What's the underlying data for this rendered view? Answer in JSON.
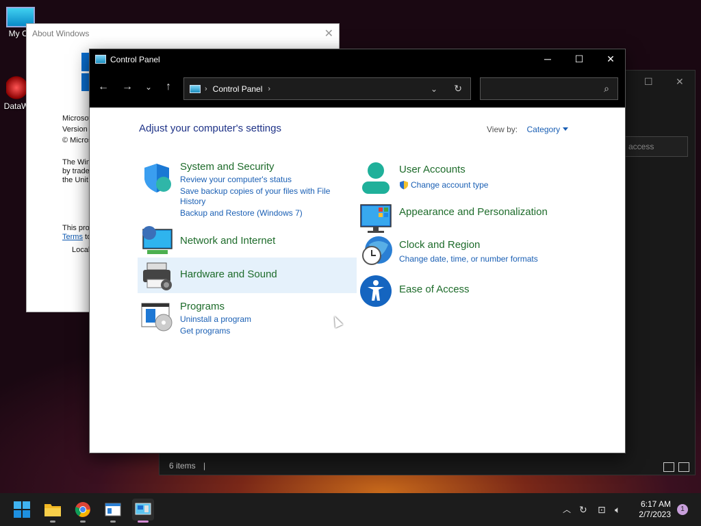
{
  "desktop": {
    "icons": [
      {
        "label": "My Co"
      },
      {
        "label": "DataW"
      }
    ]
  },
  "back_window": {
    "search_placeholder": "access",
    "status": "6 items",
    "status_sep": "|"
  },
  "about_window": {
    "title": "About Windows",
    "lines": [
      "Microsof",
      "Version",
      "© Micros"
    ],
    "para": [
      "The Win",
      "by trade",
      "the Unit"
    ],
    "license_prefix": "This pro",
    "terms": "Terms",
    "terms_suffix": "to",
    "local": "Local"
  },
  "cp": {
    "title": "Control Panel",
    "address_crumb": "Control Panel",
    "search_placeholder": "",
    "heading": "Adjust your computer's settings",
    "viewby_label": "View by:",
    "viewby_value": "Category",
    "categories": [
      {
        "title": "System and Security",
        "links": [
          "Review your computer's status",
          "Save backup copies of your files with File",
          "History",
          "Backup and Restore (Windows 7)"
        ]
      },
      {
        "title": "Network and Internet",
        "links": []
      },
      {
        "title": "Hardware and Sound",
        "links": []
      },
      {
        "title": "Programs",
        "links": [
          "Uninstall a program",
          "Get programs"
        ]
      },
      {
        "title": "User Accounts",
        "links": [
          "Change account type"
        ]
      },
      {
        "title": "Appearance and Personalization",
        "links": []
      },
      {
        "title": "Clock and Region",
        "links": [
          "Change date, time, or number formats"
        ]
      },
      {
        "title": "Ease of Access",
        "links": []
      }
    ]
  },
  "taskbar": {
    "time": "6:17 AM",
    "date": "2/7/2023",
    "notifications": "1"
  },
  "icons": {
    "shield": "shield-icon",
    "network": "network-icon",
    "printer": "printer-icon",
    "programs": "programs-icon",
    "user": "user-icon",
    "appearance": "appearance-icon",
    "clock": "clock-icon",
    "ease": "ease-of-access-icon"
  }
}
